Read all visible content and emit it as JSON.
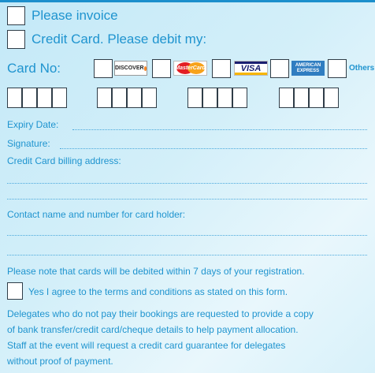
{
  "payment_options": {
    "invoice_label": "Please invoice",
    "credit_card_label": "Credit Card. Please debit my:"
  },
  "card": {
    "label": "Card No:",
    "brands": {
      "discover": "DISCOVER",
      "mastercard": "MasterCard",
      "visa": "VISA",
      "amex_line1": "AMERICAN",
      "amex_line2": "EXPRESS",
      "others": "Others"
    }
  },
  "fields": {
    "expiry": "Expiry Date:",
    "signature": "Signature:",
    "billing_address": "Credit Card billing address:",
    "contact": "Contact name and number for card holder:"
  },
  "notes": {
    "debit_notice": "Please note that cards will be debited within 7 days of your registration.",
    "terms_label": "Yes I agree to the terms and conditions as stated on this form.",
    "delegates_line1": "Delegates who do not pay their bookings are requested to provide a copy",
    "delegates_line2": "of bank transfer/credit card/cheque details to help payment allocation.",
    "delegates_line3": "Staff at the event will request a credit card guarantee for delegates",
    "delegates_line4": "without proof of payment."
  },
  "colors": {
    "text": "#1f94cf",
    "accent_bar": "#1c8fcc",
    "box_border": "#2f3d48"
  }
}
